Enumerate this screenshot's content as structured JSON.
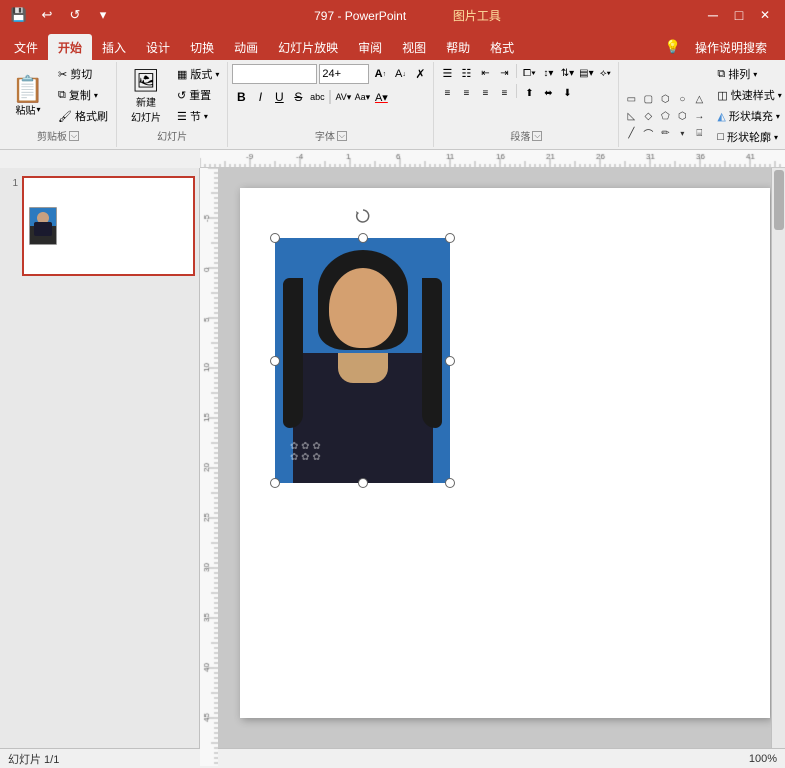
{
  "titlebar": {
    "title": "797 - PowerPoint",
    "picture_tools": "图片工具",
    "save_icon": "💾",
    "undo_icon": "↩",
    "redo_icon": "↺",
    "dropdown_icon": "▾",
    "min_btn": "─",
    "max_btn": "□",
    "close_btn": "✕"
  },
  "tabs": {
    "items": [
      "文件",
      "开始",
      "插入",
      "设计",
      "切换",
      "动画",
      "幻灯片放映",
      "审阅",
      "视图",
      "帮助",
      "格式"
    ],
    "active": "开始",
    "right_items": [
      "💡",
      "操作说明搜索"
    ]
  },
  "ribbon": {
    "groups": {
      "clipboard": {
        "label": "剪贴板",
        "paste_btn": "粘贴",
        "cut_btn": "剪切",
        "copy_btn": "复制",
        "format_btn": "格式刷"
      },
      "slides": {
        "label": "幻灯片",
        "new_btn": "新建\n幻灯片",
        "layout_btn": "版式▾",
        "reset_btn": "重置",
        "section_btn": "节▾"
      },
      "font": {
        "label": "字体",
        "font_name": "",
        "font_size": "24+",
        "bold": "B",
        "italic": "I",
        "underline": "U",
        "strikethrough": "S",
        "shadow": "abc",
        "char_spacing": "AV▾",
        "font_color_label": "Aa▾",
        "font_color": "A▾",
        "increase_font": "A↑",
        "decrease_font": "A↓",
        "clear_format": "✗"
      },
      "paragraph": {
        "label": "段落"
      },
      "drawing": {
        "label": ""
      }
    }
  },
  "slide": {
    "number": "1",
    "slide_count": "1"
  },
  "status": {
    "slide_info": "幻灯片 1/1",
    "zoom": "100%"
  }
}
